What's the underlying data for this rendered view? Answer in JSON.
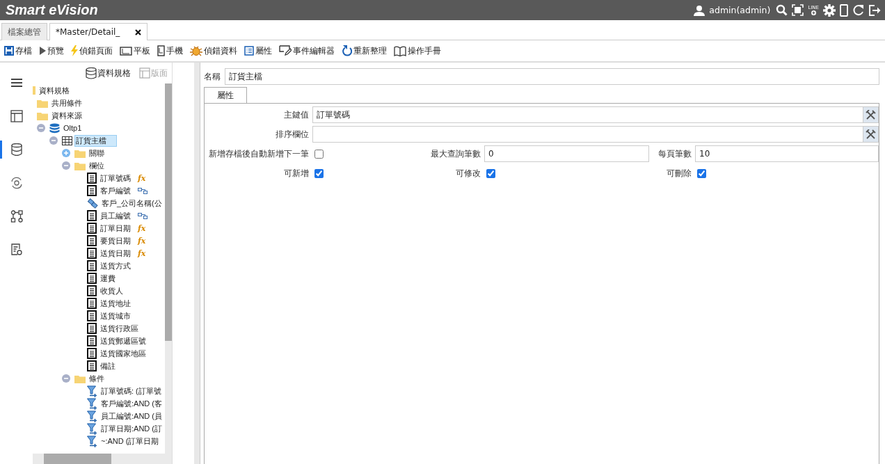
{
  "header": {
    "app_title": "Smart eVision",
    "user": "admin(admin)",
    "line_label": "LINE"
  },
  "tabs": [
    {
      "label": "檔案總管",
      "selected": false,
      "closable": false
    },
    {
      "label": "*Master/Detail_",
      "selected": true,
      "closable": true
    }
  ],
  "toolbar": [
    {
      "label": "存檔"
    },
    {
      "label": "預覽"
    },
    {
      "label": "偵錯頁面"
    },
    {
      "label": "平板"
    },
    {
      "label": "手機"
    },
    {
      "label": "偵錯資料"
    },
    {
      "label": "屬性"
    },
    {
      "label": "事件編輯器"
    },
    {
      "label": "重新整理"
    },
    {
      "label": "操作手冊"
    }
  ],
  "rail": [
    {
      "selected": false
    },
    {
      "selected": false
    },
    {
      "selected": true
    },
    {
      "selected": false
    },
    {
      "selected": false
    },
    {
      "selected": false
    }
  ],
  "tree_panel": {
    "buttons": [
      {
        "label": "資料規格",
        "disabled": false
      },
      {
        "label": "版面",
        "disabled": true
      }
    ]
  },
  "tree": {
    "items": [
      {
        "kind": "root",
        "label": "資料規格",
        "children": [
          {
            "kind": "folder",
            "label": "共用條件"
          },
          {
            "kind": "folder",
            "label": "資料來源"
          },
          {
            "kind": "database",
            "label": "Oltp1",
            "expanded": true,
            "children": [
              {
                "kind": "table",
                "label": "訂貨主檔",
                "expanded": true,
                "selected": true,
                "children": [
                  {
                    "kind": "folder",
                    "label": "關聯",
                    "expanded": false
                  },
                  {
                    "kind": "folder",
                    "label": "欄位",
                    "expanded": true,
                    "children": [
                      {
                        "kind": "field",
                        "label": "訂單號碼",
                        "tag": "fx"
                      },
                      {
                        "kind": "key-field",
                        "label": "客戶編號"
                      },
                      {
                        "kind": "joined-field",
                        "label": "客戶_公司名稱(公"
                      },
                      {
                        "kind": "key-field",
                        "label": "員工編號"
                      },
                      {
                        "kind": "field",
                        "label": "訂單日期",
                        "tag": "fx"
                      },
                      {
                        "kind": "field",
                        "label": "要貨日期",
                        "tag": "fx"
                      },
                      {
                        "kind": "field",
                        "label": "送貨日期",
                        "tag": "fx"
                      },
                      {
                        "kind": "field",
                        "label": "送貨方式"
                      },
                      {
                        "kind": "field",
                        "label": "運費"
                      },
                      {
                        "kind": "field",
                        "label": "收貨人"
                      },
                      {
                        "kind": "field",
                        "label": "送貨地址"
                      },
                      {
                        "kind": "field",
                        "label": "送貨城市"
                      },
                      {
                        "kind": "field",
                        "label": "送貨行政區"
                      },
                      {
                        "kind": "field",
                        "label": "送貨郵遞區號"
                      },
                      {
                        "kind": "field",
                        "label": "送貨國家地區"
                      },
                      {
                        "kind": "field",
                        "label": "備註"
                      }
                    ]
                  },
                  {
                    "kind": "folder",
                    "label": "條件",
                    "expanded": true,
                    "children": [
                      {
                        "kind": "filter",
                        "label": "訂單號碼: (訂單號"
                      },
                      {
                        "kind": "filter",
                        "label": "客戶編號:AND (客"
                      },
                      {
                        "kind": "filter",
                        "label": "員工編號:AND (員"
                      },
                      {
                        "kind": "filter",
                        "label": "訂單日期:AND (訂"
                      },
                      {
                        "kind": "filter",
                        "label": "~:AND (訂單日期"
                      }
                    ]
                  }
                ]
              }
            ]
          }
        ]
      }
    ]
  },
  "name_field": {
    "label": "名稱",
    "value": "訂貨主檔"
  },
  "prop_tabs": [
    {
      "label": "屬性",
      "selected": true
    }
  ],
  "form": {
    "primary_key": {
      "label": "主鍵值",
      "value": "訂單號碼"
    },
    "sort_field": {
      "label": "排序欄位"
    },
    "auto_new": {
      "label": "新增存檔後自動新增下一筆",
      "checked": false
    },
    "max_rows": {
      "label": "最大查詢筆數",
      "value": "0"
    },
    "page_size": {
      "label": "每頁筆數",
      "value": "10"
    },
    "permissions": [
      {
        "label": "可新增",
        "checked": true
      },
      {
        "label": "可修改",
        "checked": true
      },
      {
        "label": "可刪除",
        "checked": true
      }
    ]
  }
}
